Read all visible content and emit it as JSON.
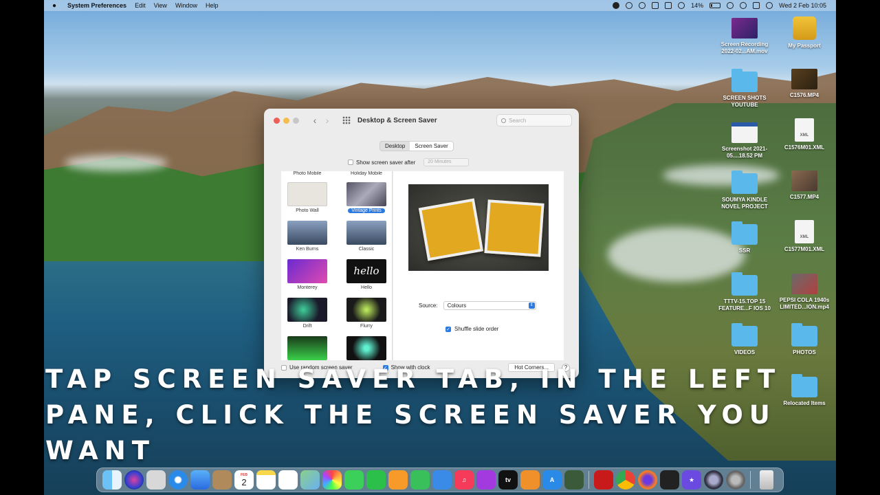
{
  "menubar": {
    "app_name": "System Preferences",
    "menus": [
      "Edit",
      "View",
      "Window",
      "Help"
    ],
    "battery_percent": "14%",
    "datetime": "Wed 2 Feb  10:05"
  },
  "desktop_icons": [
    {
      "label": "Screen Recording 2022-02...AM.mov",
      "kind": "video-thumb"
    },
    {
      "label": "My Passport",
      "kind": "drive"
    },
    {
      "label": "SCREEN SHOTS YOUTUBE",
      "kind": "folder"
    },
    {
      "label": "C1576.MP4",
      "kind": "video-thumb"
    },
    {
      "label": "Screenshot 2021-05....18.52 PM",
      "kind": "image-thumb"
    },
    {
      "label": "C1576M01.XML",
      "kind": "xml-doc"
    },
    {
      "label": "SOUMYA KINDLE NOVEL PROJECT",
      "kind": "folder"
    },
    {
      "label": "C1577.MP4",
      "kind": "video-thumb"
    },
    {
      "label": "SSR",
      "kind": "folder"
    },
    {
      "label": "C1577M01.XML",
      "kind": "xml-doc"
    },
    {
      "label": "TTTV-15.TOP 15 FEATURE...F IOS 10",
      "kind": "folder"
    },
    {
      "label": "PEPSI COLA 1940s LIMITED...ION.mp4",
      "kind": "video-thumb"
    },
    {
      "label": "VIDEOS",
      "kind": "folder"
    },
    {
      "label": "PHOTOS",
      "kind": "folder"
    },
    {
      "label": "Relocated Items",
      "kind": "folder"
    }
  ],
  "xml_badge": "XML",
  "window": {
    "title": "Desktop & Screen Saver",
    "search_placeholder": "Search",
    "tabs": [
      "Desktop",
      "Screen Saver"
    ],
    "active_tab": "Screen Saver",
    "show_after_label": "Show screen saver after",
    "show_after_value": "20 Minutes",
    "screen_savers": [
      "Photo Mobile",
      "Holiday Mobile",
      "Photo Wall",
      "Vintage Prints",
      "Ken Burns",
      "Classic",
      "Monterey",
      "Hello",
      "Drift",
      "Flurry"
    ],
    "selected_saver": "Vintage Prints",
    "hello_glyph": "hello",
    "source_label": "Source:",
    "source_value": "Colours",
    "shuffle_label": "Shuffle slide order",
    "random_label": "Use random screen saver",
    "clock_label": "Show with clock",
    "hot_corners_label": "Hot Corners...",
    "help_label": "?"
  },
  "caption": "TAP SCREEN SAVER TAB, IN THE LEFT PANE, CLICK THE SCREEN SAVER YOU WANT",
  "dock": {
    "calendar_month": "FEB",
    "calendar_day": "2",
    "apple_tv_label": "tv",
    "apps": [
      "finder",
      "siri",
      "launchpad",
      "safari",
      "mail",
      "contacts",
      "calendar",
      "notes",
      "reminders",
      "maps",
      "photos",
      "messages",
      "facetime",
      "pages",
      "numbers",
      "keynote",
      "music",
      "podcasts",
      "apple-tv",
      "books",
      "app-store",
      "keychain",
      "acrobat",
      "chrome",
      "firefox",
      "final-cut",
      "imovie",
      "quicktime",
      "system-preferences",
      "trash"
    ]
  }
}
